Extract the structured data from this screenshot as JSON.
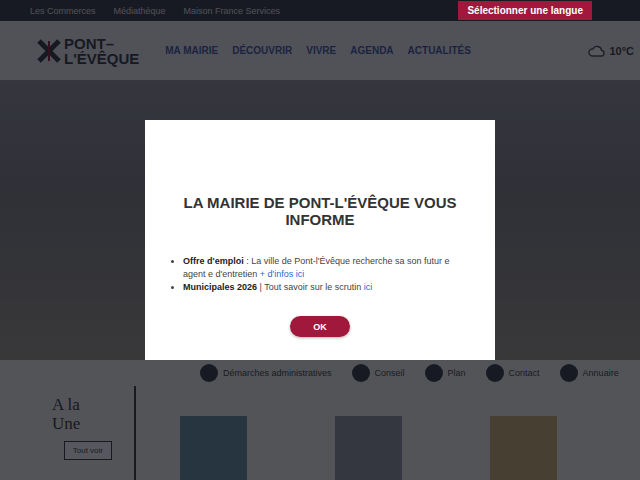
{
  "top_bar": {
    "links": [
      "Les Commerces",
      "Médiathèque",
      "Maison France Services"
    ],
    "language_button": "Sélectionner une langue"
  },
  "header": {
    "logo": {
      "line1": "PONT–",
      "line2": "L'ÉVÊQUE"
    },
    "nav": [
      "MA MAIRIE",
      "DÉCOUVRIR",
      "VIVRE",
      "AGENDA",
      "ACTUALITÉS"
    ],
    "weather": "10°C"
  },
  "quick_links": [
    "Démarches administratives",
    "Conseil",
    "Plan",
    "Contact",
    "Annuaire"
  ],
  "news": {
    "heading_line1": "A la",
    "heading_line2": "Une",
    "button": "Tout voir"
  },
  "modal": {
    "title": "LA MAIRIE DE PONT-L'ÉVÊQUE VOUS INFORME",
    "items": [
      {
        "label": "Offre d'emploi",
        "text": " : La ville de Pont-l'Évêque recherche sa son futur e agent e d'entretien ",
        "link": "+ d'infos ici"
      },
      {
        "label": "Municipales 2026",
        "text": " | Tout savoir sur le scrutin ",
        "link": "ici"
      }
    ],
    "button": "OK"
  }
}
